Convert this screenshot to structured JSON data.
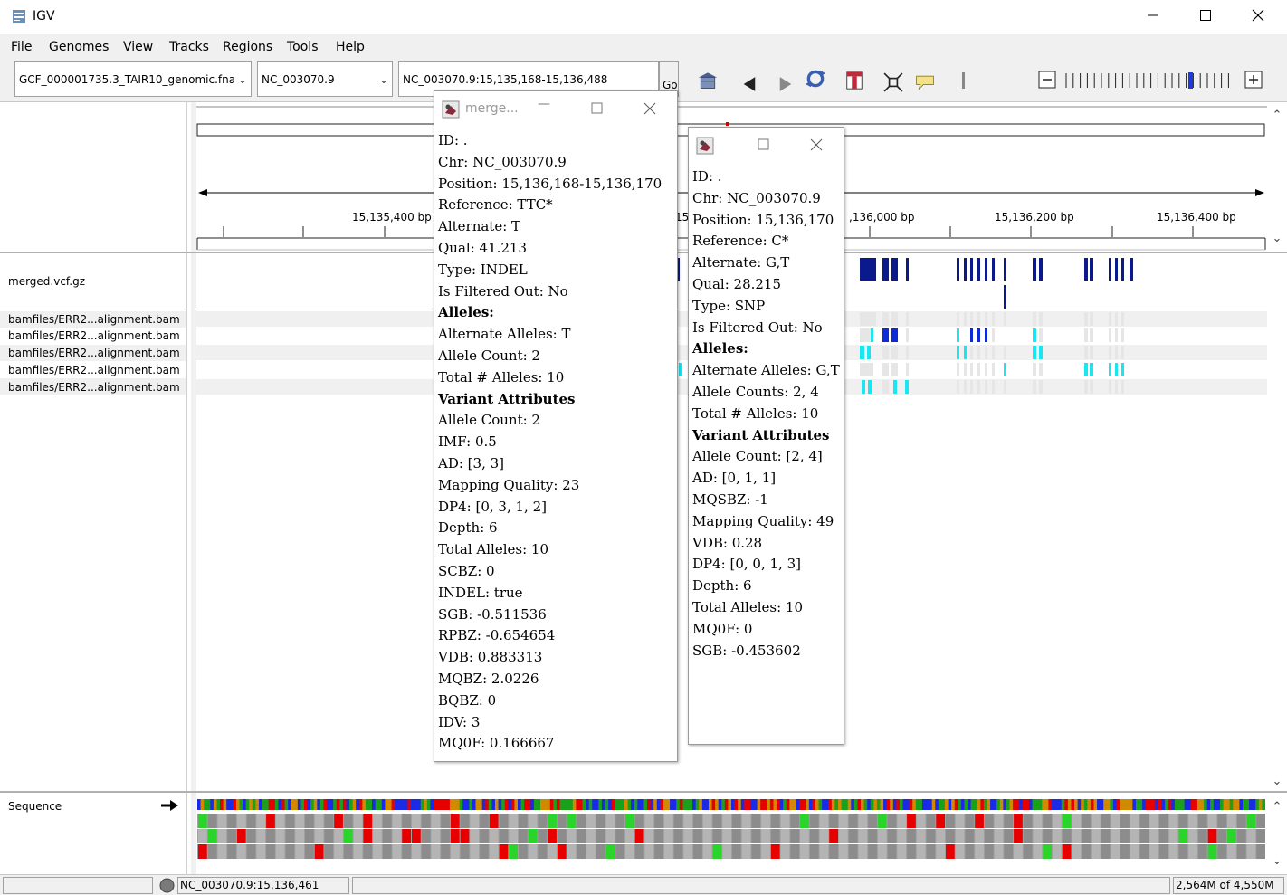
{
  "window": {
    "title": "IGV"
  },
  "menu": [
    "File",
    "Genomes",
    "View",
    "Tracks",
    "Regions",
    "Tools",
    "Help"
  ],
  "toolbar": {
    "genome": "GCF_000001735.3_TAIR10_genomic.fna",
    "chromosome": "NC_003070.9",
    "locus": "NC_003070.9:15,135,168-15,136,488",
    "go_label": "Go"
  },
  "ruler": {
    "ticks": [
      "15,135,400 bp",
      "15,",
      ",136,000 bp",
      "15,136,200 bp",
      "15,136,400 bp"
    ]
  },
  "tracks": {
    "vcf": "merged.vcf.gz",
    "samples": [
      "bamfiles/ERR2...alignment.bam",
      "bamfiles/ERR2...alignment.bam",
      "bamfiles/ERR2...alignment.bam",
      "bamfiles/ERR2...alignment.bam",
      "bamfiles/ERR2...alignment.bam"
    ],
    "sequence": "Sequence"
  },
  "colors": {
    "variant_dark": "#0a1a8c",
    "hom_var": "#0c2ad6",
    "het_var": "#19e6f0",
    "no_call": "#e6e6e6",
    "base_A": "#1aa01a",
    "base_C": "#1a2ae6",
    "base_G": "#d18a00",
    "base_T": "#e60000",
    "ruler_marker": "#d40000"
  },
  "popup1": {
    "title": "merge...",
    "lines": [
      {
        "t": "ID: .",
        "b": false
      },
      {
        "t": "Chr: NC_003070.9",
        "b": false
      },
      {
        "t": "Position: 15,136,168-15,136,170",
        "b": false
      },
      {
        "t": "Reference: TTC*",
        "b": false
      },
      {
        "t": "Alternate: T",
        "b": false
      },
      {
        "t": "Qual: 41.213",
        "b": false
      },
      {
        "t": "Type: INDEL",
        "b": false
      },
      {
        "t": "Is Filtered Out: No",
        "b": false
      },
      {
        "t": "Alleles:",
        "b": true
      },
      {
        "t": "Alternate Alleles: T",
        "b": false
      },
      {
        "t": "Allele Count: 2",
        "b": false
      },
      {
        "t": "Total # Alleles: 10",
        "b": false
      },
      {
        "t": "Variant Attributes",
        "b": true
      },
      {
        "t": "Allele Count: 2",
        "b": false
      },
      {
        "t": "IMF: 0.5",
        "b": false
      },
      {
        "t": "AD: [3, 3]",
        "b": false
      },
      {
        "t": "Mapping Quality: 23",
        "b": false
      },
      {
        "t": "DP4: [0, 3, 1, 2]",
        "b": false
      },
      {
        "t": "Depth: 6",
        "b": false
      },
      {
        "t": "Total Alleles: 10",
        "b": false
      },
      {
        "t": "SCBZ: 0",
        "b": false
      },
      {
        "t": "INDEL: true",
        "b": false
      },
      {
        "t": "SGB: -0.511536",
        "b": false
      },
      {
        "t": "RPBZ: -0.654654",
        "b": false
      },
      {
        "t": "VDB: 0.883313",
        "b": false
      },
      {
        "t": "MQBZ: 2.0226",
        "b": false
      },
      {
        "t": "BQBZ: 0",
        "b": false
      },
      {
        "t": "IDV: 3",
        "b": false
      },
      {
        "t": "MQ0F: 0.166667",
        "b": false
      }
    ]
  },
  "popup2": {
    "lines": [
      {
        "t": "ID: .",
        "b": false
      },
      {
        "t": "Chr: NC_003070.9",
        "b": false
      },
      {
        "t": "Position: 15,136,170",
        "b": false
      },
      {
        "t": "Reference: C*",
        "b": false
      },
      {
        "t": "Alternate: G,T",
        "b": false
      },
      {
        "t": "Qual: 28.215",
        "b": false
      },
      {
        "t": "Type: SNP",
        "b": false
      },
      {
        "t": "Is Filtered Out: No",
        "b": false
      },
      {
        "t": "Alleles:",
        "b": true
      },
      {
        "t": "Alternate Alleles: G,T",
        "b": false
      },
      {
        "t": "Allele Counts: 2, 4",
        "b": false
      },
      {
        "t": "Total # Alleles: 10",
        "b": false
      },
      {
        "t": "Variant Attributes",
        "b": true
      },
      {
        "t": "Allele Count: [2, 4]",
        "b": false
      },
      {
        "t": "AD: [0, 1, 1]",
        "b": false
      },
      {
        "t": "MQSBZ: -1",
        "b": false
      },
      {
        "t": "Mapping Quality: 49",
        "b": false
      },
      {
        "t": "VDB: 0.28",
        "b": false
      },
      {
        "t": "DP4: [0, 0, 1, 3]",
        "b": false
      },
      {
        "t": "Depth: 6",
        "b": false
      },
      {
        "t": "Total Alleles: 10",
        "b": false
      },
      {
        "t": "MQ0F: 0",
        "b": false
      },
      {
        "t": "SGB: -0.453602",
        "b": false
      }
    ]
  },
  "status": {
    "position": "NC_003070.9:15,136,461",
    "memory": "2,564M of 4,550M"
  }
}
